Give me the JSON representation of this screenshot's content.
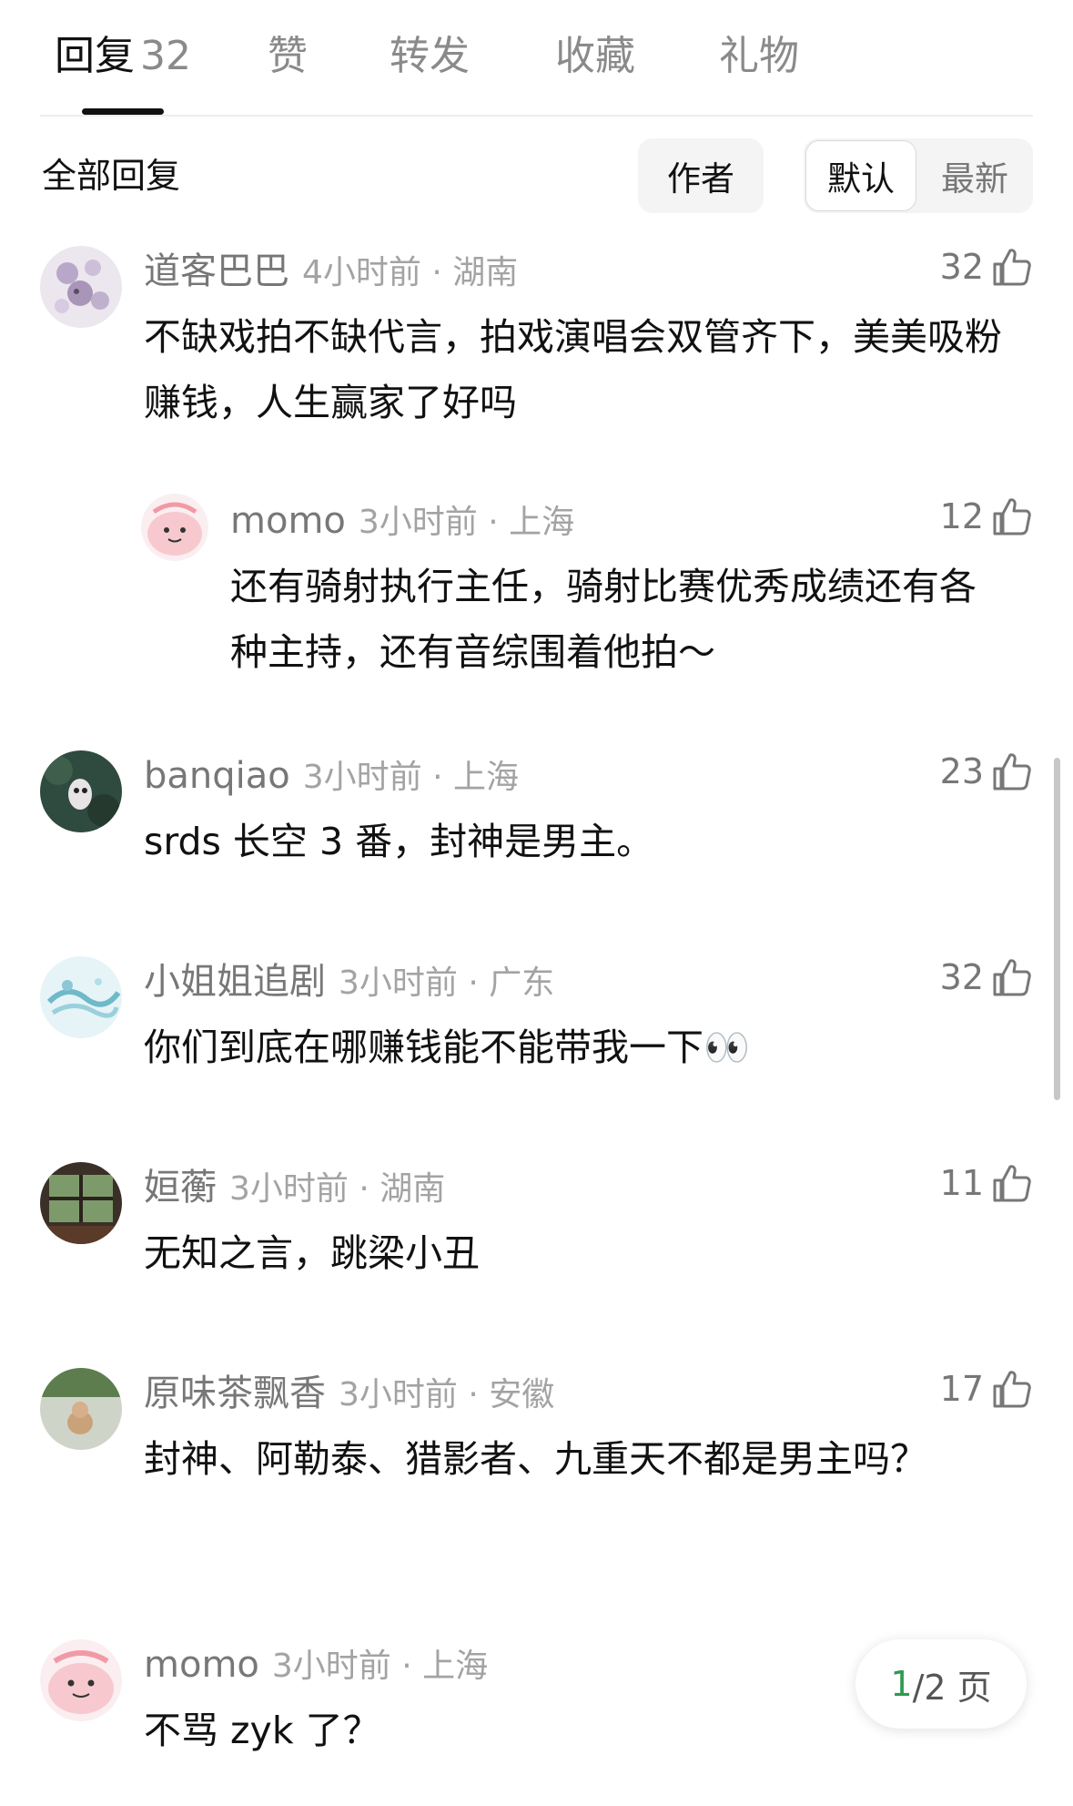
{
  "tabs": [
    {
      "label": "回复",
      "count": "32"
    },
    {
      "label": "赞"
    },
    {
      "label": "转发"
    },
    {
      "label": "收藏"
    },
    {
      "label": "礼物"
    }
  ],
  "filter": {
    "label": "全部回复",
    "author": "作者",
    "default": "默认",
    "newest": "最新"
  },
  "comments": [
    {
      "user": "道客巴巴",
      "time": "4小时前",
      "region": "湖南",
      "likes": "32",
      "text": "不缺戏拍不缺代言，拍戏演唱会双管齐下，美美吸粉赚钱，人生赢家了好吗",
      "avatar": "floral-avatar"
    },
    {
      "user": "momo",
      "time": "3小时前",
      "region": "上海",
      "likes": "12",
      "text": "还有骑射执行主任，骑射比赛优秀成绩还有各种主持，还有音综围着他拍～",
      "avatar": "pink-cartoon-avatar"
    },
    {
      "user": "banqiao",
      "time": "3小时前",
      "region": "上海",
      "likes": "23",
      "text": "srds 长空 3 番，封神是男主。",
      "avatar": "dark-green-avatar"
    },
    {
      "user": "小姐姐追剧",
      "time": "3小时前",
      "region": "广东",
      "likes": "32",
      "text": "你们到底在哪赚钱能不能带我一下👀",
      "avatar": "water-splash-avatar"
    },
    {
      "user": "姮蘅",
      "time": "3小时前",
      "region": "湖南",
      "likes": "11",
      "text": "无知之言，跳梁小丑",
      "avatar": "window-avatar"
    },
    {
      "user": "原味茶飘香",
      "time": "3小时前",
      "region": "安徽",
      "likes": "17",
      "text": "封神、阿勒泰、猎影者、九重天不都是男主吗？",
      "avatar": "dog-avatar"
    },
    {
      "user": "momo",
      "time": "3小时前",
      "region": "上海",
      "likes": "",
      "text": "不骂 zyk 了？",
      "avatar": "pink-cartoon-avatar"
    }
  ],
  "meta_separator": "·",
  "pager": {
    "current": "1",
    "total_suffix": "/2 页"
  },
  "colors": {
    "accent_green": "#2e9b4f",
    "meta_gray": "#a3a3a3",
    "username_gray": "#777777"
  }
}
